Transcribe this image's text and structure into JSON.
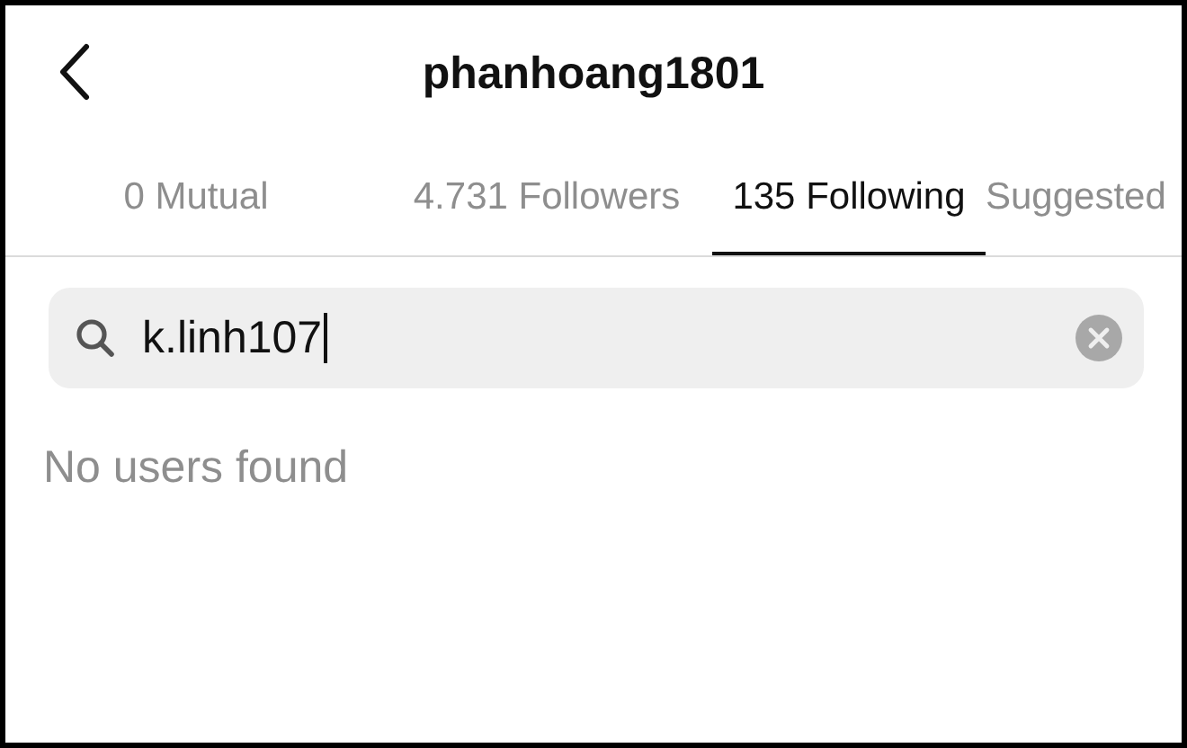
{
  "header": {
    "title": "phanhoang1801"
  },
  "tabs": [
    {
      "label": "0 Mutual",
      "selected": false
    },
    {
      "label": "4.731 Followers",
      "selected": false
    },
    {
      "label": "135 Following",
      "selected": true
    },
    {
      "label": "Suggested",
      "selected": false
    }
  ],
  "search": {
    "value": "k.linh107"
  },
  "message": "No users found"
}
